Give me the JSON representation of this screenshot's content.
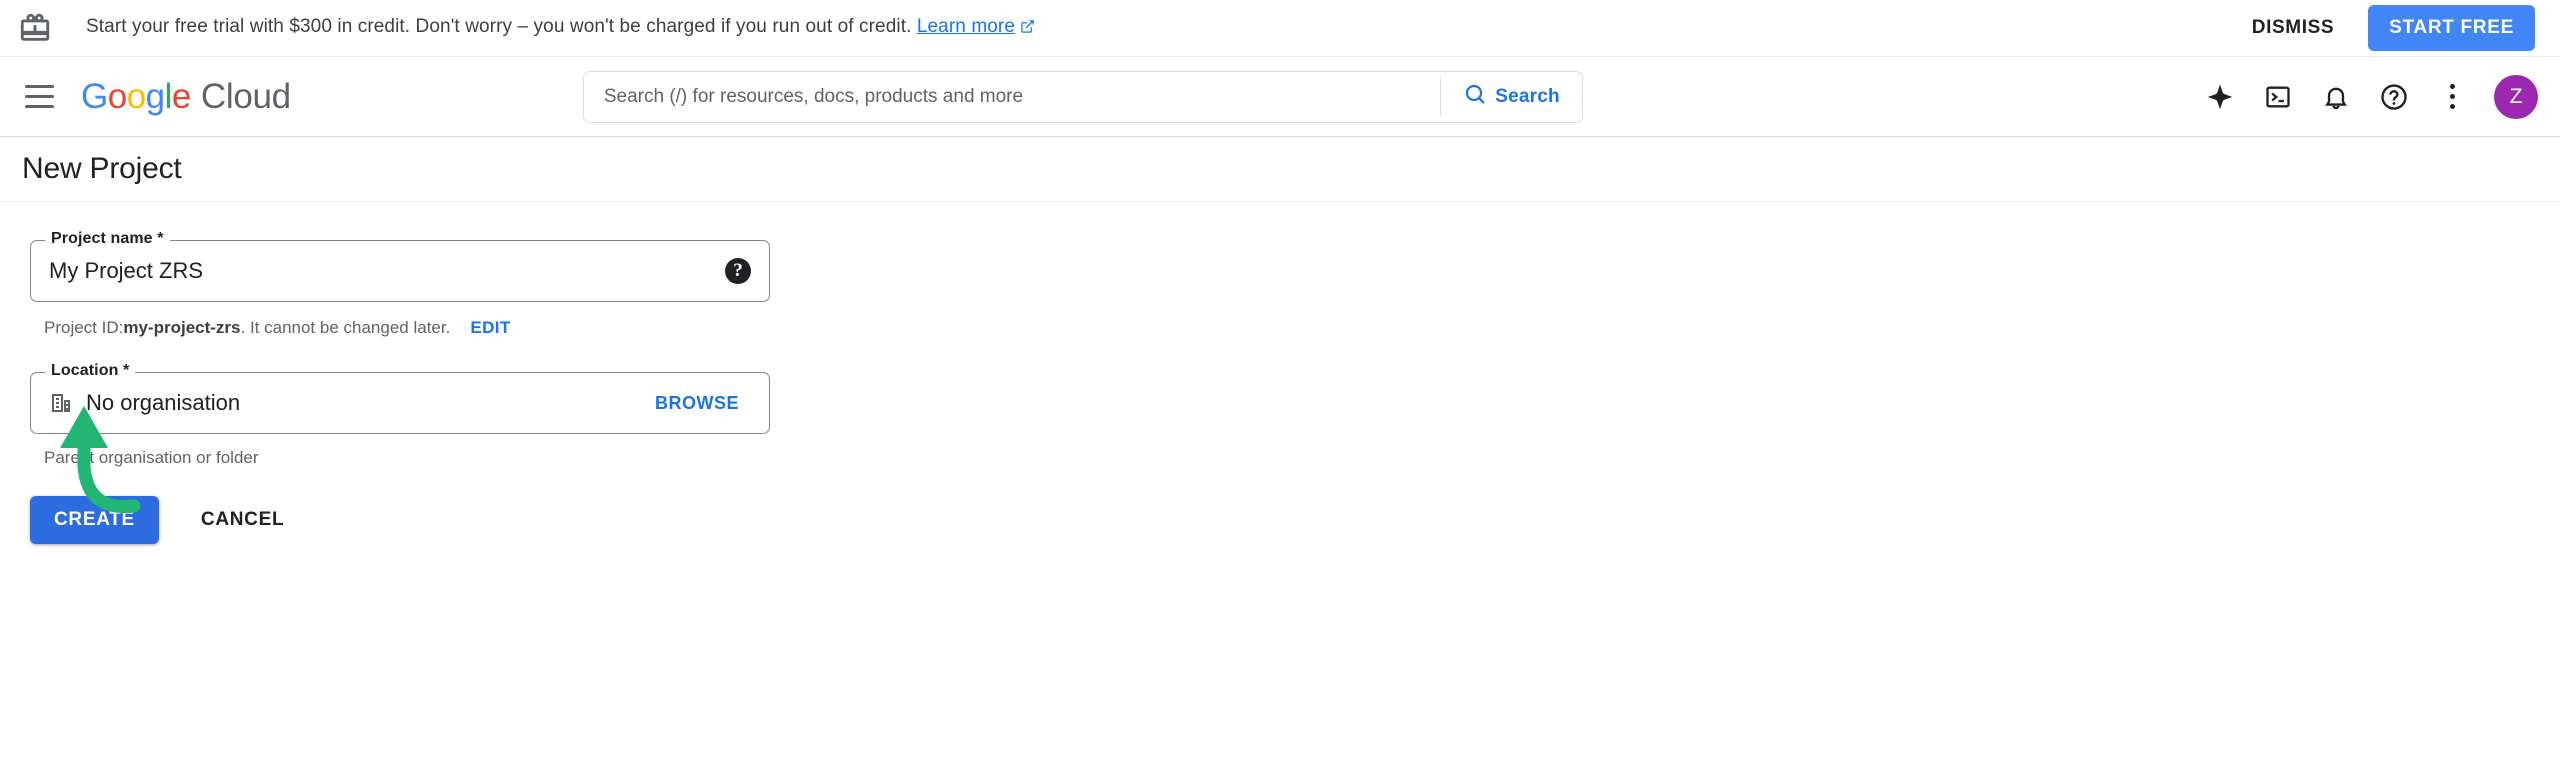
{
  "banner": {
    "gift_icon": "gift-icon",
    "text_before_link": "Start your free trial with $300 in credit. Don't worry – you won't be charged if you run out of credit.",
    "link_label": "Learn more",
    "external_link_icon": "external-link-icon",
    "dismiss_label": "DISMISS",
    "start_free_label": "START FREE",
    "start_free_color": "#4285f4"
  },
  "topnav": {
    "menu_icon": "hamburger-menu-icon",
    "brand_google": "Google",
    "brand_google_letters": [
      "G",
      "o",
      "o",
      "g",
      "l",
      "e"
    ],
    "brand_cloud": "Cloud",
    "search": {
      "placeholder": "Search (/) for resources, docs, products and more",
      "value": "",
      "button_label": "Search",
      "button_icon": "search-icon",
      "button_color": "#1a73e8"
    },
    "icons": [
      {
        "name": "gemini-sparkle-icon",
        "title": "Gemini"
      },
      {
        "name": "cloud-shell-icon",
        "title": "Activate Cloud Shell"
      },
      {
        "name": "notifications-bell-icon",
        "title": "Notifications"
      },
      {
        "name": "help-question-icon",
        "title": "Support"
      },
      {
        "name": "more-options-kebab-icon",
        "title": "Settings and utilities"
      }
    ],
    "avatar": {
      "initial": "Z",
      "color": "#9c27b0"
    }
  },
  "page": {
    "title": "New Project"
  },
  "form": {
    "project_name": {
      "label": "Project name *",
      "value": "My Project ZRS",
      "placeholder": "",
      "help_icon": "help-filled-icon"
    },
    "project_id": {
      "prefix": "Project ID: ",
      "id": "my-project-zrs",
      "suffix": ". It cannot be changed later.",
      "edit_label": "EDIT"
    },
    "location": {
      "label": "Location *",
      "icon": "organisation-building-icon",
      "value": "No organisation",
      "browse_label": "BROWSE",
      "helper": "Parent organisation or folder"
    },
    "create_label": "CREATE",
    "cancel_label": "CANCEL",
    "create_color": "#2d6cdf"
  },
  "annotation": {
    "arrow_icon": "curved-up-arrow-annotation",
    "color": "#22b573",
    "points_at": "CREATE"
  }
}
